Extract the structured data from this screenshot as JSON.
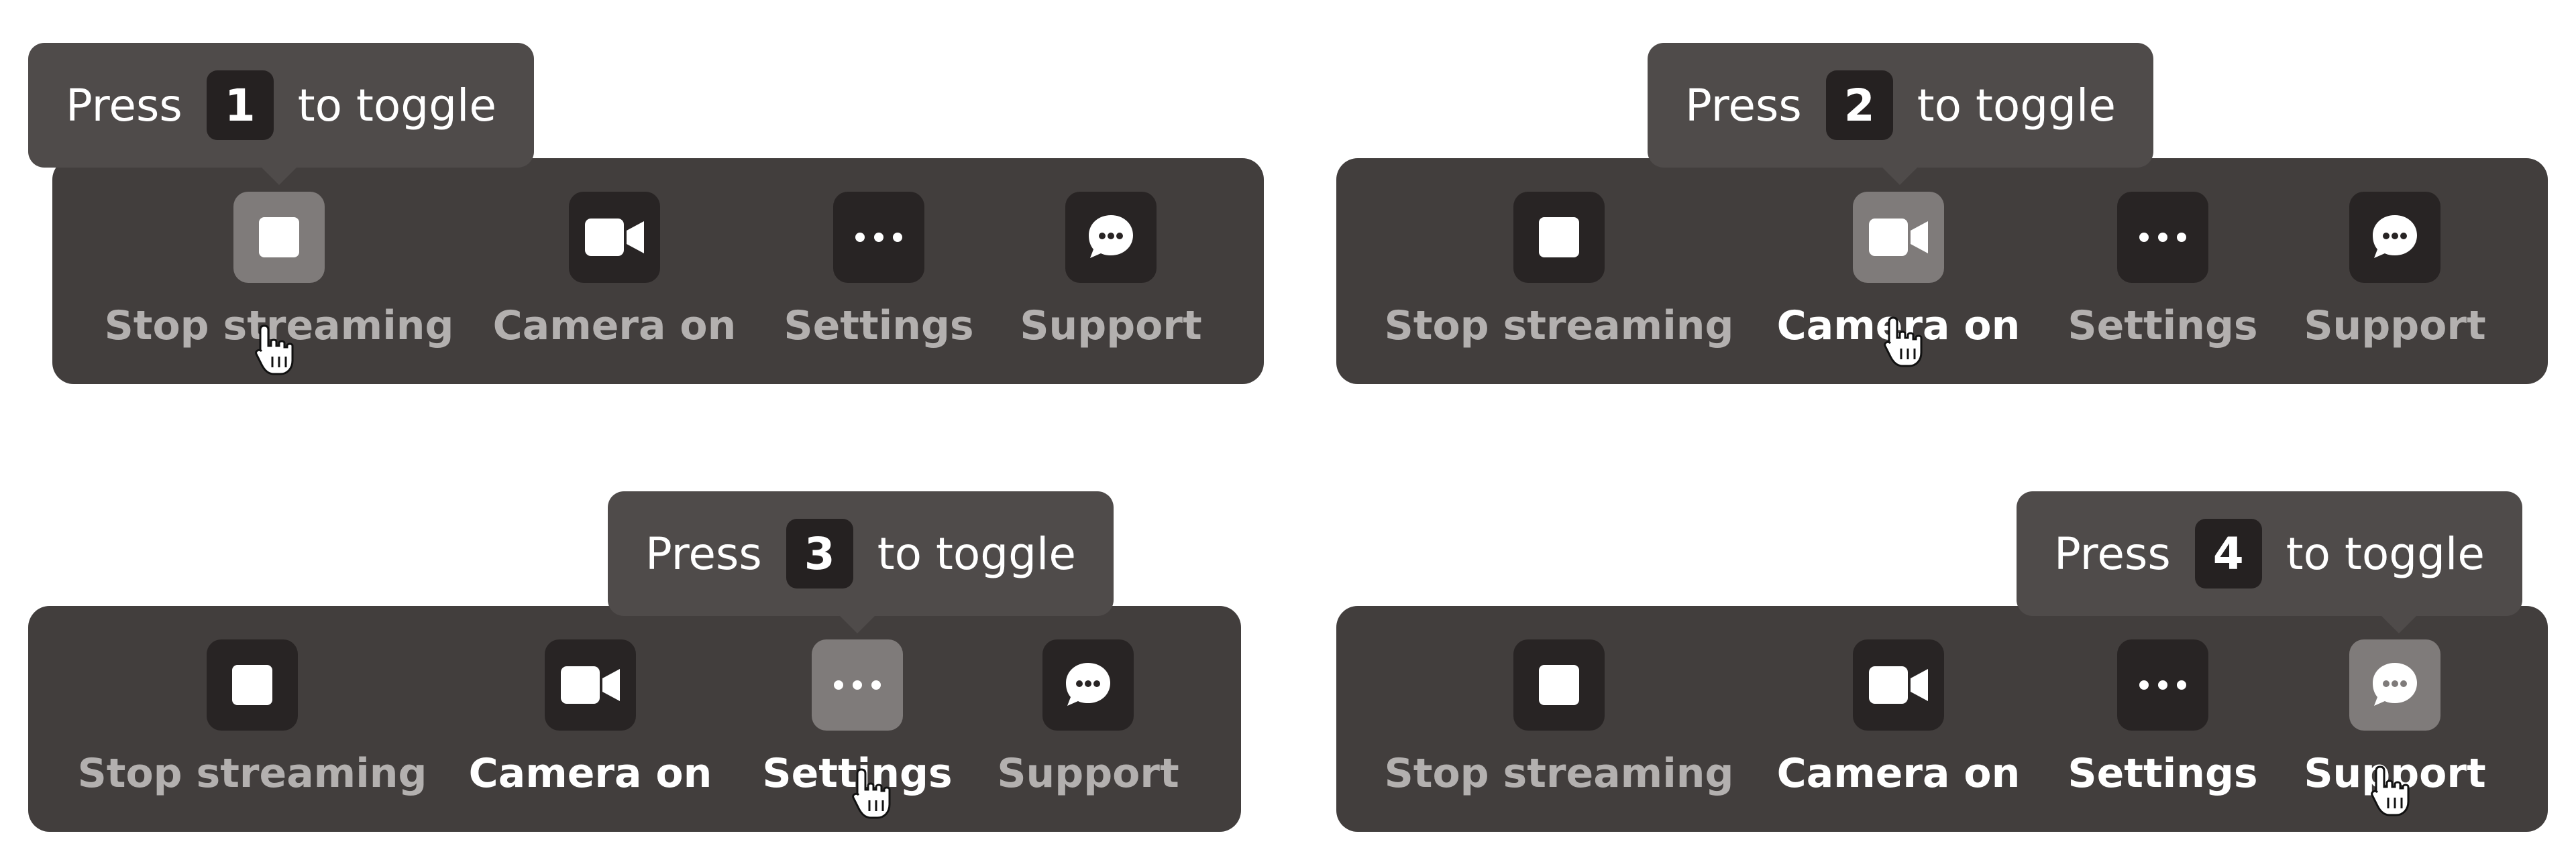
{
  "panels": [
    {
      "tooltip": {
        "prefix": "Press",
        "key": "1",
        "suffix": "to toggle"
      },
      "active_index": 0,
      "items": [
        {
          "label": "Stop streaming",
          "icon": "stop-icon",
          "bright": true
        },
        {
          "label": "Camera on",
          "icon": "camera-icon",
          "bright": false
        },
        {
          "label": "Settings",
          "icon": "more-dots-icon",
          "bright": false
        },
        {
          "label": "Support",
          "icon": "chat-bubble-icon",
          "bright": false
        }
      ]
    },
    {
      "tooltip": {
        "prefix": "Press",
        "key": "2",
        "suffix": "to toggle"
      },
      "active_index": 1,
      "items": [
        {
          "label": "Stop streaming",
          "icon": "stop-icon",
          "bright": false
        },
        {
          "label": "Camera on",
          "icon": "camera-icon",
          "bright": true
        },
        {
          "label": "Settings",
          "icon": "more-dots-icon",
          "bright": false
        },
        {
          "label": "Support",
          "icon": "chat-bubble-icon",
          "bright": false
        }
      ]
    },
    {
      "tooltip": {
        "prefix": "Press",
        "key": "3",
        "suffix": "to toggle"
      },
      "active_index": 2,
      "items": [
        {
          "label": "Stop streaming",
          "icon": "stop-icon",
          "bright": false
        },
        {
          "label": "Camera on",
          "icon": "camera-icon",
          "bright": true
        },
        {
          "label": "Settings",
          "icon": "more-dots-icon",
          "bright": true
        },
        {
          "label": "Support",
          "icon": "chat-bubble-icon",
          "bright": false
        }
      ]
    },
    {
      "tooltip": {
        "prefix": "Press",
        "key": "4",
        "suffix": "to toggle"
      },
      "active_index": 3,
      "items": [
        {
          "label": "Stop streaming",
          "icon": "stop-icon",
          "bright": false
        },
        {
          "label": "Camera on",
          "icon": "camera-icon",
          "bright": true
        },
        {
          "label": "Settings",
          "icon": "more-dots-icon",
          "bright": true
        },
        {
          "label": "Support",
          "icon": "chat-bubble-icon",
          "bright": true
        }
      ]
    }
  ],
  "colors": {
    "toolbar_bg": "#423e3d",
    "tooltip_bg": "#4f4b4a",
    "icon_box": "#282424",
    "icon_box_active": "#7f7b7a",
    "label_dim": "#b3b0af",
    "label_bright": "#ffffff"
  }
}
